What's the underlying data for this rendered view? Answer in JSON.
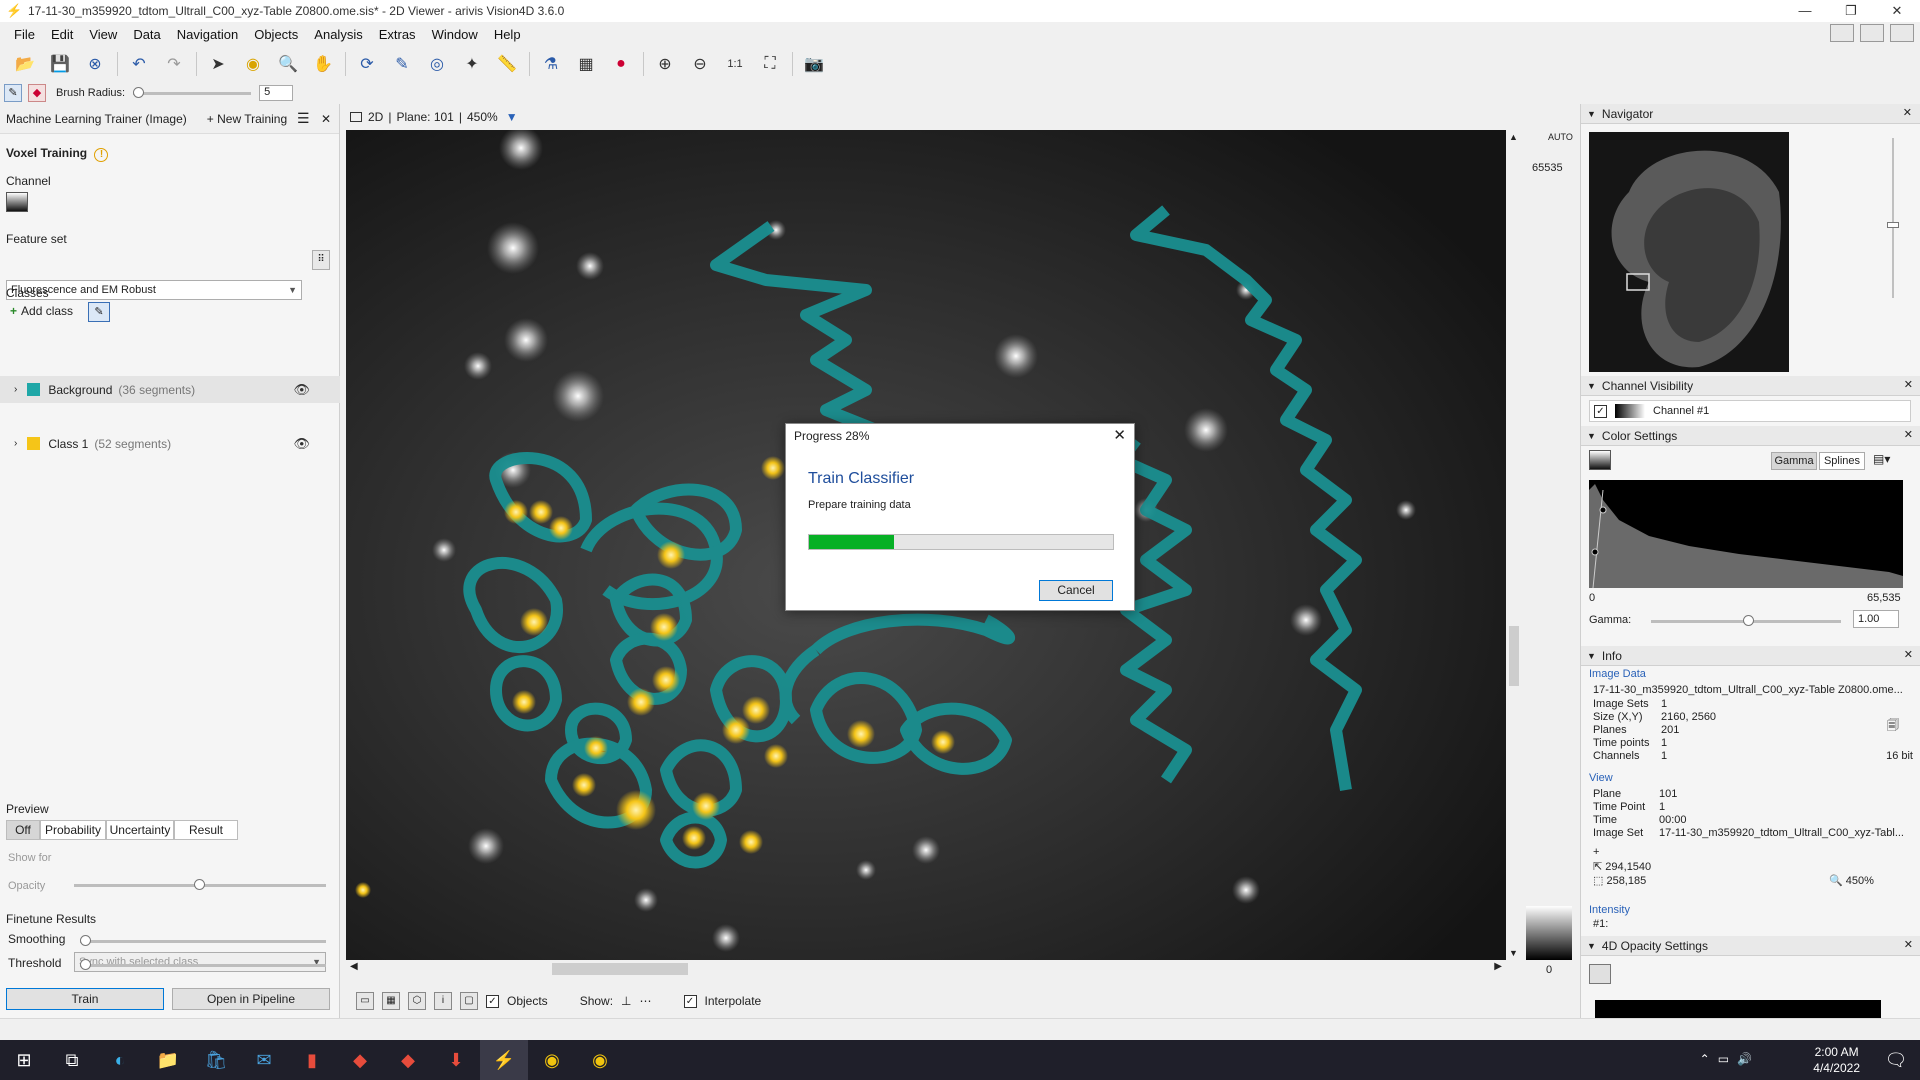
{
  "window": {
    "title": "17-11-30_m359920_tdtom_Ultrall_C00_xyz-Table Z0800.ome.sis* - 2D Viewer - arivis Vision4D 3.6.0"
  },
  "menu": [
    "File",
    "Edit",
    "View",
    "Data",
    "Navigation",
    "Objects",
    "Analysis",
    "Extras",
    "Window",
    "Help"
  ],
  "brush": {
    "label": "Brush Radius:",
    "value": "5"
  },
  "left_panel": {
    "header_title": "Machine Learning Trainer (Image)",
    "new_training": "New Training",
    "voxel_training": "Voxel Training",
    "channel_label": "Channel",
    "feature_set_label": "Feature set",
    "feature_set_value": "Fluorescence and EM Robust",
    "classes_label": "Classes",
    "add_class": "Add class",
    "classes": [
      {
        "name": "Background",
        "count": "(36 segments)",
        "color": "#1fa7a7"
      },
      {
        "name": "Class 1",
        "count": "(52 segments)",
        "color": "#f5c518"
      }
    ],
    "preview_label": "Preview",
    "preview_tabs": [
      "Off",
      "Probability",
      "Uncertainty",
      "Result"
    ],
    "show_for_label": "Show for",
    "show_for_value": "Sync with selected class",
    "opacity_label": "Opacity",
    "finetune_label": "Finetune Results",
    "smoothing_label": "Smoothing",
    "threshold_label": "Threshold",
    "train_button": "Train",
    "pipeline_button": "Open in Pipeline"
  },
  "viewer": {
    "mode": "2D",
    "plane": "Plane: 101",
    "zoom": "450%",
    "lut_max": "65535",
    "lut_auto": "AUTO",
    "lut_min": "0",
    "footer_objects": "Objects",
    "footer_show": "Show:",
    "footer_interpolate": "Interpolate"
  },
  "dialog": {
    "header": "Progress 28%",
    "title": "Train Classifier",
    "subtitle": "Prepare training data",
    "progress": 28,
    "cancel": "Cancel"
  },
  "right_panel": {
    "navigator": "Navigator",
    "channel_visibility": "Channel Visibility",
    "channel_name": "Channel #1",
    "color_settings": "Color Settings",
    "gamma_tab": "Gamma",
    "splines_tab": "Splines",
    "hist_min": "0",
    "hist_max": "65,535",
    "gamma_label": "Gamma:",
    "gamma_value": "1.00",
    "info": "Info",
    "image_data": "Image Data",
    "file_name": "17-11-30_m359920_tdtom_Ultrall_C00_xyz-Table Z0800.ome...",
    "info_rows": [
      {
        "label": "Image Sets",
        "value": "1"
      },
      {
        "label": "Size (X,Y)",
        "value": "2160, 2560"
      },
      {
        "label": "Planes",
        "value": "201"
      },
      {
        "label": "Time points",
        "value": "1"
      },
      {
        "label": "Channels",
        "value": "1"
      }
    ],
    "bit_depth": "16 bit",
    "view_label": "View",
    "view_rows": [
      {
        "label": "Plane",
        "value": "101"
      },
      {
        "label": "Time Point",
        "value": "1"
      },
      {
        "label": "Time",
        "value": "00:00"
      },
      {
        "label": "Image Set",
        "value": "17-11-30_m359920_tdtom_Ultrall_C00_xyz-Tabl..."
      }
    ],
    "coord1": "294,1540",
    "coord2": "258,185",
    "view_zoom": "450%",
    "intensity_label": "Intensity",
    "intensity_value": "#1:",
    "opacity_settings": "4D Opacity Settings"
  },
  "taskbar": {
    "time": "2:00 AM",
    "date": "4/4/2022"
  }
}
